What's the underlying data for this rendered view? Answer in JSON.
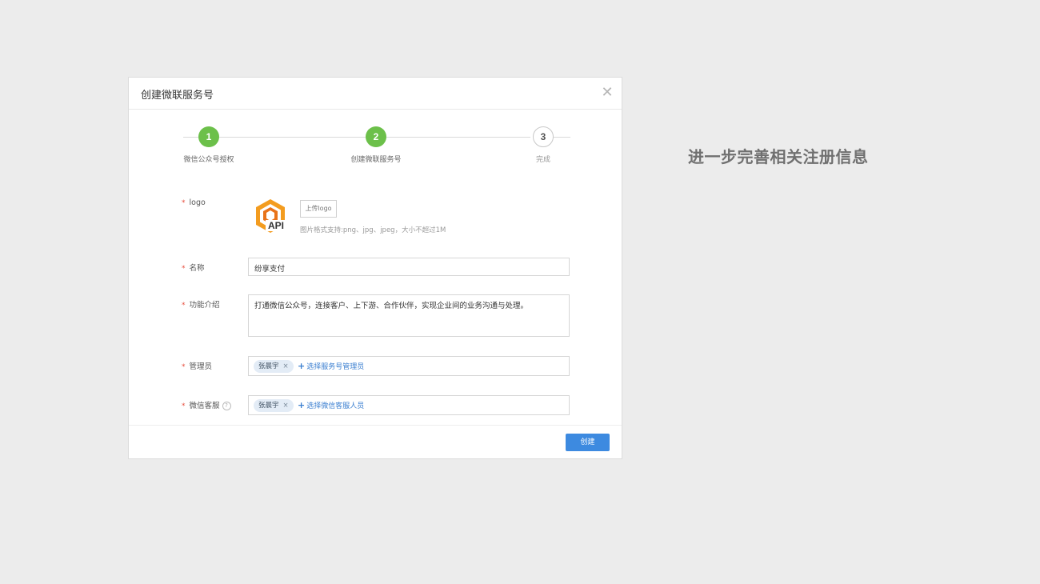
{
  "dialog": {
    "title": "创建微联服务号",
    "close_icon": "close-icon"
  },
  "steps": [
    {
      "number": "1",
      "label": "微信公众号授权",
      "status": "done"
    },
    {
      "number": "2",
      "label": "创建微联服务号",
      "status": "done"
    },
    {
      "number": "3",
      "label": "完成",
      "status": "todo"
    }
  ],
  "form": {
    "required_mark": "*",
    "logo": {
      "label": "logo",
      "image_text": "API",
      "upload_label": "上传logo",
      "hint": "图片格式支持:png、jpg、jpeg，大小不超过1M"
    },
    "name": {
      "label": "名称",
      "value": "纷享支付"
    },
    "intro": {
      "label": "功能介绍",
      "value": "打通微信公众号，连接客户、上下游、合作伙伴，实现企业间的业务沟通与处理。"
    },
    "admin": {
      "label": "管理员",
      "tag": "张晨宇",
      "tag_remove": "×",
      "add_label": "选择服务号管理员"
    },
    "customer_service": {
      "label": "微信客服",
      "help": "?",
      "tag": "张晨宇",
      "tag_remove": "×",
      "add_label": "选择微信客服人员"
    }
  },
  "footer": {
    "create_label": "创建"
  },
  "caption": "进一步完善相关注册信息",
  "colors": {
    "step_done": "#6cc04a",
    "primary": "#3d8ae0",
    "link": "#3b7fd0",
    "required": "#e74c3c"
  }
}
